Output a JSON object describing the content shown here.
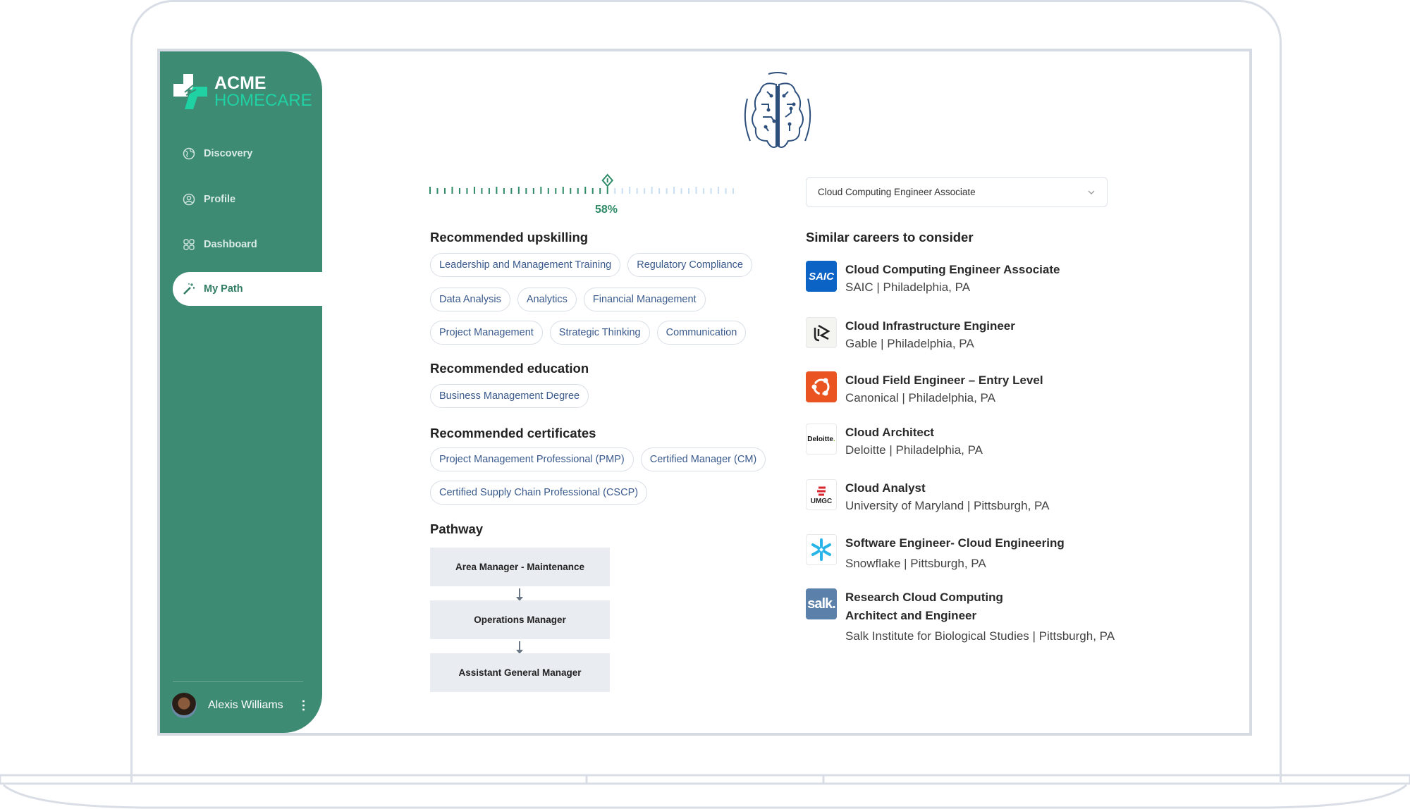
{
  "brand": {
    "line1": "ACME",
    "line2": "HOMECARE"
  },
  "sidebar": {
    "items": [
      {
        "label": "Discovery",
        "icon": "globe-icon"
      },
      {
        "label": "Profile",
        "icon": "user-circle-icon"
      },
      {
        "label": "Dashboard",
        "icon": "grid-icon"
      },
      {
        "label": "My Path",
        "icon": "magic-wand-icon",
        "active": true
      }
    ],
    "user": {
      "name": "Alexis Williams"
    }
  },
  "progress": {
    "value": 58,
    "label": "58%"
  },
  "career_select": {
    "value": "Cloud Computing Engineer Associate"
  },
  "upskilling": {
    "title": "Recommended upskilling",
    "rows": [
      [
        "Leadership and Management Training",
        "Regulatory Compliance"
      ],
      [
        "Data Analysis",
        "Analytics",
        "Financial Management"
      ],
      [
        "Project Management",
        "Strategic Thinking",
        "Communication"
      ]
    ]
  },
  "education": {
    "title": "Recommended education",
    "rows": [
      [
        "Business Management Degree"
      ]
    ]
  },
  "certificates": {
    "title": "Recommended certificates",
    "rows": [
      [
        "Project Management Professional (PMP)",
        "Certified Manager (CM)"
      ],
      [
        "Certified Supply Chain Professional (CSCP)"
      ]
    ]
  },
  "pathway": {
    "title": "Pathway",
    "steps": [
      "Area Manager - Maintenance",
      "Operations Manager",
      "Assistant General Manager"
    ]
  },
  "similar": {
    "title": "Similar careers to consider",
    "items": [
      {
        "title": "Cloud Computing Engineer Associate",
        "sub": "SAIC | Philadelphia, PA",
        "logo": "SAIC"
      },
      {
        "title": "Cloud Infrastructure Engineer",
        "sub": "Gable | Philadelphia, PA",
        "logo": "Gable"
      },
      {
        "title": "Cloud Field Engineer – Entry Level",
        "sub": "Canonical | Philadelphia, PA",
        "logo": "Canonical"
      },
      {
        "title": "Cloud Architect",
        "sub": "Deloitte | Philadelphia, PA",
        "logo": "Deloitte."
      },
      {
        "title": "Cloud Analyst",
        "sub": "University of Maryland | Pittsburgh, PA",
        "logo": "UMGC"
      },
      {
        "title": "Software Engineer- Cloud Engineering",
        "sub": "Snowflake | Pittsburgh, PA",
        "logo": "Snowflake"
      },
      {
        "title": "Research Cloud Computing Architect and Engineer",
        "sub": "Salk Institute for Biological Studies | Pittsburgh, PA",
        "logo": "salk."
      }
    ]
  },
  "colors": {
    "sidebar": "#3d8b73",
    "accent": "#2e8b67",
    "chip_text": "#3a5a8c",
    "brain": "#2d4f7c"
  }
}
